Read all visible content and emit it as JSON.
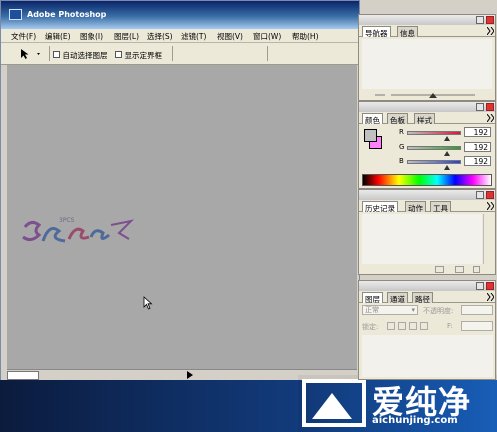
{
  "window": {
    "title": "Adobe Photoshop"
  },
  "menu": [
    "文件(F)",
    "编辑(E)",
    "图象(I)",
    "图层(L)",
    "选择(S)",
    "滤镜(T)",
    "视图(V)",
    "窗口(W)",
    "帮助(H)"
  ],
  "options": {
    "auto_select_layer": "自动选择图层",
    "show_bounding_box": "显示定界框"
  },
  "navigator": {
    "tabs": [
      "导航器",
      "信息"
    ]
  },
  "color": {
    "tabs": [
      "颜色",
      "色板",
      "样式"
    ],
    "channels": [
      {
        "label": "R",
        "value": "192",
        "fill": 0.753,
        "color": "#e0143c"
      },
      {
        "label": "G",
        "value": "192",
        "fill": 0.753,
        "color": "#2d9b2d"
      },
      {
        "label": "B",
        "value": "192",
        "fill": 0.753,
        "color": "#2540d8"
      }
    ],
    "foreground": "#c0c0c0",
    "background": "#ff80ff"
  },
  "history": {
    "tabs": [
      "历史记录",
      "动作",
      "工具"
    ]
  },
  "layers": {
    "tabs": [
      "图层",
      "通道",
      "路径"
    ],
    "blend_mode": "正常",
    "opacity_label": "不透明度:",
    "lock_label": "锁定:",
    "fill_label": "F:"
  },
  "watermark": {
    "brand": "爱纯净",
    "url": "aichunjing.com",
    "pc_text": "3PCS"
  }
}
